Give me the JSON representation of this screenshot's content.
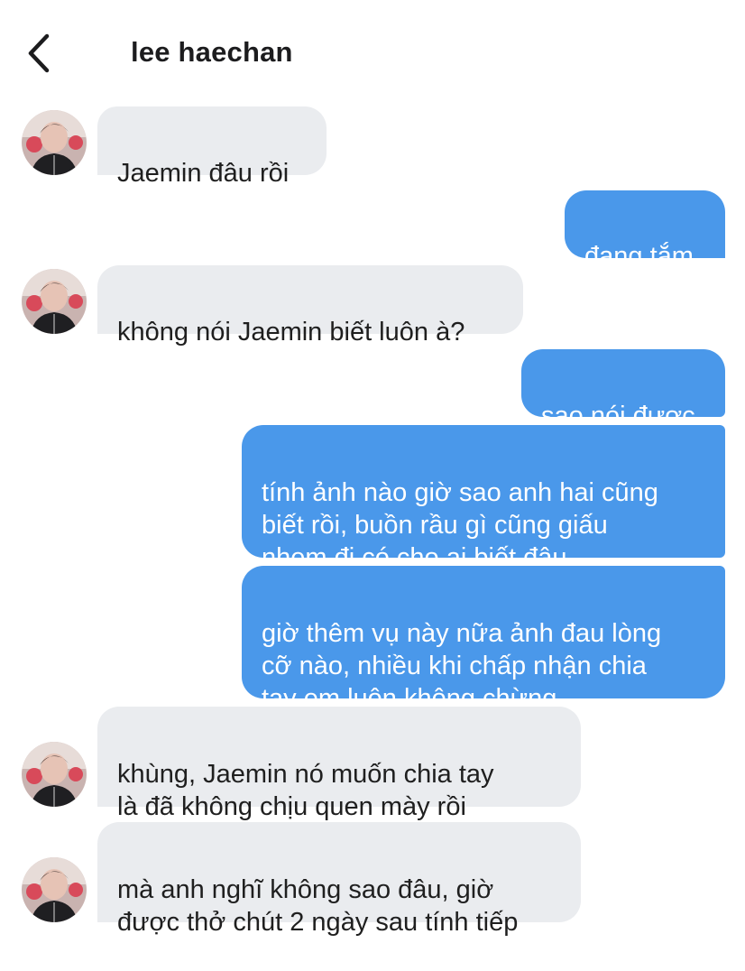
{
  "header": {
    "back_label": "back",
    "contact_name": "lee haechan"
  },
  "messages": [
    {
      "sender": "incoming",
      "text": "Jaemin đâu rồi"
    },
    {
      "sender": "outgoing",
      "text": "đang tắm"
    },
    {
      "sender": "incoming",
      "text": "không nói Jaemin biết luôn à?"
    },
    {
      "sender": "outgoing",
      "text": "sao nói được"
    },
    {
      "sender": "outgoing",
      "text": "tính ảnh nào giờ sao anh hai cũng\nbiết rồi, buồn rầu gì cũng giấu\nnhẹm đi có cho ai biết đâu"
    },
    {
      "sender": "outgoing",
      "text": "giờ thêm vụ này nữa ảnh đau lòng\ncỡ nào, nhiều khi chấp nhận chia\ntay em luôn không chừng"
    },
    {
      "sender": "incoming",
      "text": "khùng, Jaemin nó muốn chia tay\nlà đã không chịu quen mày rồi"
    },
    {
      "sender": "incoming",
      "text": "mà anh nghĩ không sao đâu, giờ\nđược thở chút 2 ngày sau tính tiếp"
    }
  ],
  "colors": {
    "incoming_bubble": "#eaecef",
    "outgoing_bubble": "#4a98ea",
    "outgoing_text": "#ffffff",
    "incoming_text": "#1f1f1f"
  },
  "icons": {
    "back": "chevron-left-icon",
    "avatar": "contact-avatar"
  }
}
